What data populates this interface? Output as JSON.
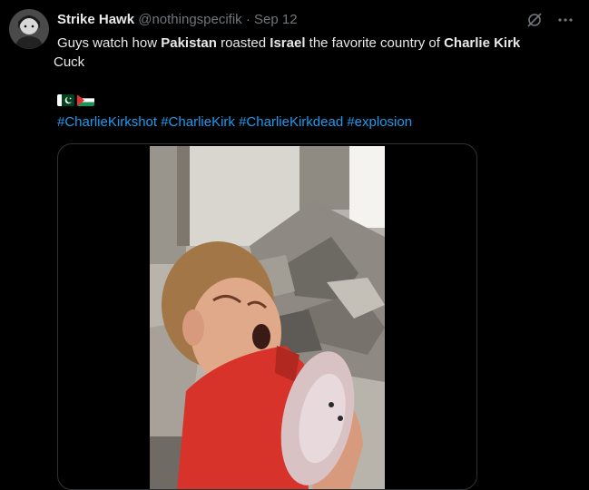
{
  "tweet": {
    "author_name": "Strike Hawk",
    "handle": "@nothingspecifik",
    "separator": "·",
    "date": "Sep 12",
    "text_parts": [
      {
        "text": "Guys watch how ",
        "bold": false
      },
      {
        "text": "Pakistan",
        "bold": true
      },
      {
        "text": " roasted ",
        "bold": false
      },
      {
        "text": "Israel",
        "bold": true
      },
      {
        "text": " the favorite country of ",
        "bold": false
      },
      {
        "text": "Charlie Kirk",
        "bold": true
      },
      {
        "text": " Cuck",
        "bold": false
      }
    ],
    "flags": [
      "pakistan-flag",
      "palestine-flag"
    ],
    "hashtags": [
      "#CharlieKirkshot",
      "#CharlieKirk",
      "#CharlieKirkdead",
      "#explosion"
    ],
    "icons": [
      "grok-icon",
      "more-icon"
    ]
  },
  "colors": {
    "background": "#000000",
    "text": "#e7e9ea",
    "muted": "#71767b",
    "link": "#1d9bf0",
    "border": "#2f3336"
  }
}
